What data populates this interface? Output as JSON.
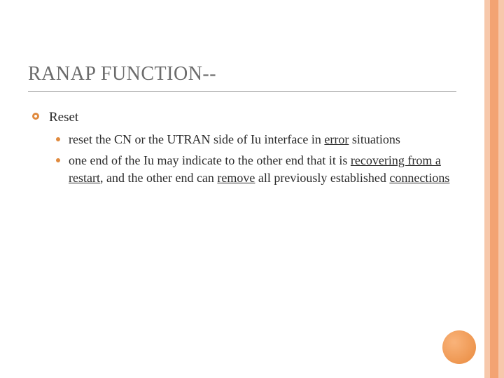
{
  "title": "RANAP FUNCTION--",
  "section": {
    "heading": "Reset",
    "items": [
      {
        "segments": [
          {
            "text": "reset the CN or the UTRAN side of Iu interface in ",
            "u": false
          },
          {
            "text": "error",
            "u": true
          },
          {
            "text": " situations",
            "u": false
          }
        ]
      },
      {
        "segments": [
          {
            "text": "one end of the Iu may indicate to the other end that it is ",
            "u": false
          },
          {
            "text": "recovering from a restart",
            "u": true
          },
          {
            "text": ", and the other end can ",
            "u": false
          },
          {
            "text": "remove",
            "u": true
          },
          {
            "text": " all previously established ",
            "u": false
          },
          {
            "text": "connections",
            "u": true
          }
        ]
      }
    ]
  }
}
